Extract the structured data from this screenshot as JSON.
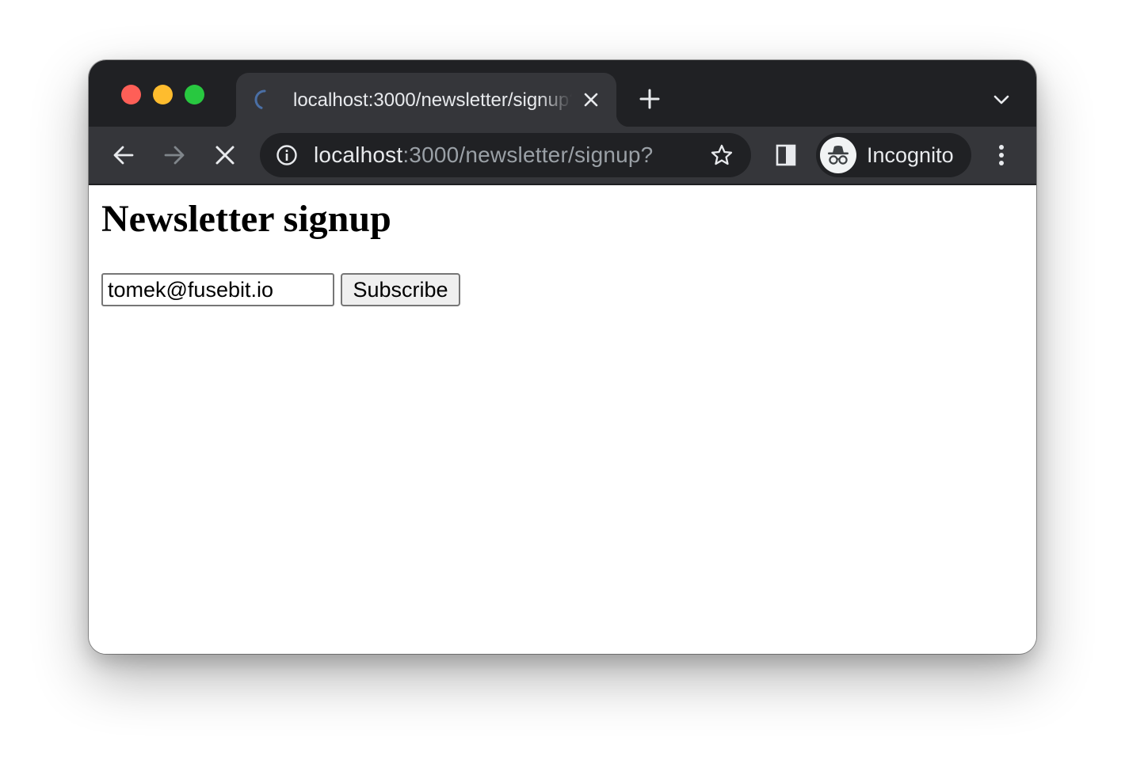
{
  "browser": {
    "tab": {
      "title": "localhost:3000/newsletter/signup?",
      "favicon": "loading-spinner-icon"
    },
    "new_tab_icon": "plus-icon",
    "tab_search_icon": "chevron-down-icon",
    "nav": {
      "back_icon": "arrow-left-icon",
      "forward_icon": "arrow-right-icon",
      "stop_icon": "close-icon"
    },
    "address_bar": {
      "host": "localhost",
      "rest": ":3000/newsletter/signup?",
      "security_icon": "info-icon",
      "bookmark_icon": "star-icon"
    },
    "side_panel_icon": "side-panel-icon",
    "profile": {
      "label": "Incognito",
      "icon": "incognito-icon"
    },
    "menu_icon": "kebab-menu-icon",
    "colors": {
      "tabstrip": "#202124",
      "toolbar": "#35363a",
      "omnibox": "#202124",
      "text_primary": "#e8eaed",
      "text_secondary": "#9aa0a6",
      "spinner": "#4a6fa5"
    }
  },
  "page": {
    "heading": "Newsletter signup",
    "form": {
      "email_value": "tomek@fusebit.io",
      "submit_label": "Subscribe"
    }
  }
}
